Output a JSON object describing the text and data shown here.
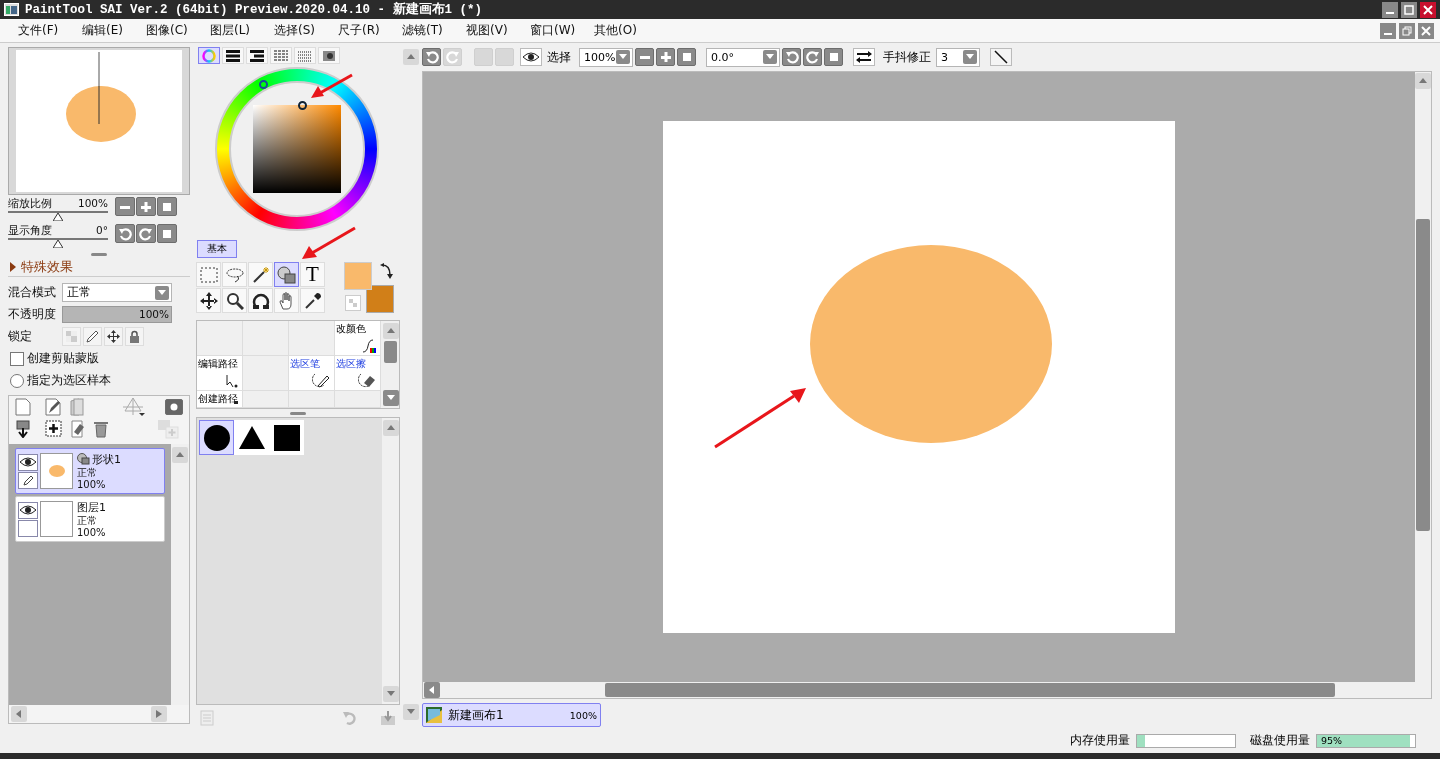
{
  "window": {
    "title": "PaintTool SAI Ver.2 (64bit) Preview.2020.04.10 - 新建画布1 (*)"
  },
  "menu": [
    "文件(F)",
    "编辑(E)",
    "图像(C)",
    "图层(L)",
    "选择(S)",
    "尺子(R)",
    "滤镜(T)",
    "视图(V)",
    "窗口(W)",
    "其他(O)"
  ],
  "navigator": {
    "sliders": [
      {
        "label": "缩放比例",
        "reading": "100%",
        "level": 0.5
      },
      {
        "label": "显示角度",
        "reading": "0°",
        "level": 0.5
      }
    ]
  },
  "effects": {
    "title": "特殊效果",
    "expanded": false
  },
  "layer_properties": {
    "blend_label": "混合模式",
    "blend_value": "正常",
    "opacity_label": "不透明度",
    "opacity": {
      "level": 1,
      "reading": "100%"
    },
    "lock_label": "锁定",
    "options": [
      {
        "kind": "checkbox",
        "label": "创建剪贴蒙版",
        "checked": false
      },
      {
        "kind": "radio",
        "label": "指定为选区样本",
        "checked": false
      }
    ]
  },
  "layers": [
    {
      "kind": "shape",
      "name": "形状1",
      "blend": "正常",
      "opacity": "100%",
      "selected": true
    },
    {
      "kind": "raster",
      "name": "图层1",
      "blend": "正常",
      "opacity": "100%",
      "selected": false
    }
  ],
  "color_modes": [
    {
      "kind": "wheel",
      "selected": true
    },
    {
      "kind": "rgb",
      "selected": false
    },
    {
      "kind": "hsv",
      "selected": false
    },
    {
      "kind": "swatches",
      "selected": false
    },
    {
      "kind": "palette",
      "selected": false
    },
    {
      "kind": "scratchpad",
      "selected": false
    }
  ],
  "color_tab": {
    "label": "基本",
    "selected": true
  },
  "tools": [
    {
      "kind": "rect-select",
      "selected": false
    },
    {
      "kind": "lasso",
      "selected": false
    },
    {
      "kind": "magic-wand",
      "selected": false
    },
    {
      "kind": "shape",
      "selected": true
    },
    {
      "kind": "text",
      "label": "T",
      "selected": false
    },
    {
      "kind": "move",
      "selected": false
    },
    {
      "kind": "zoom",
      "selected": false
    },
    {
      "kind": "rotate",
      "selected": false
    },
    {
      "kind": "hand",
      "selected": false
    },
    {
      "kind": "eyedropper",
      "selected": false
    }
  ],
  "swatches": [
    {
      "kind": "foreground",
      "color": "#f9b96b"
    },
    {
      "kind": "background",
      "color": "#d17f18"
    }
  ],
  "sub_tools": [
    {
      "kind": "empty"
    },
    {
      "kind": "empty"
    },
    {
      "kind": "empty"
    },
    {
      "kind": "color-adjust",
      "label": "改颜色"
    },
    {
      "kind": "path-edit",
      "label": "编辑路径"
    },
    {
      "kind": "empty"
    },
    {
      "kind": "selection-pen",
      "label": "选区笔"
    },
    {
      "kind": "selection-eraser",
      "label": "选区擦"
    },
    {
      "kind": "path-create",
      "label": "创建路径"
    },
    {
      "kind": "empty"
    },
    {
      "kind": "empty"
    },
    {
      "kind": "empty"
    }
  ],
  "shapes": [
    {
      "kind": "circle",
      "selected": true
    },
    {
      "kind": "triangle",
      "selected": false
    },
    {
      "kind": "square",
      "selected": false
    }
  ],
  "toolbar": {
    "select_label": "选择",
    "zoom": "100%",
    "angle": "0.0°",
    "stabilizer_label": "手抖修正",
    "stabilizer": "3"
  },
  "canvas_tabs": [
    {
      "name": "新建画布1",
      "zoom": "100%",
      "selected": true
    }
  ],
  "status": {
    "memory_label": "内存使用量",
    "memory": {
      "level": 0.08
    },
    "disk_label": "磁盘使用量",
    "disk": {
      "level": 0.95,
      "reading": "95%"
    }
  }
}
